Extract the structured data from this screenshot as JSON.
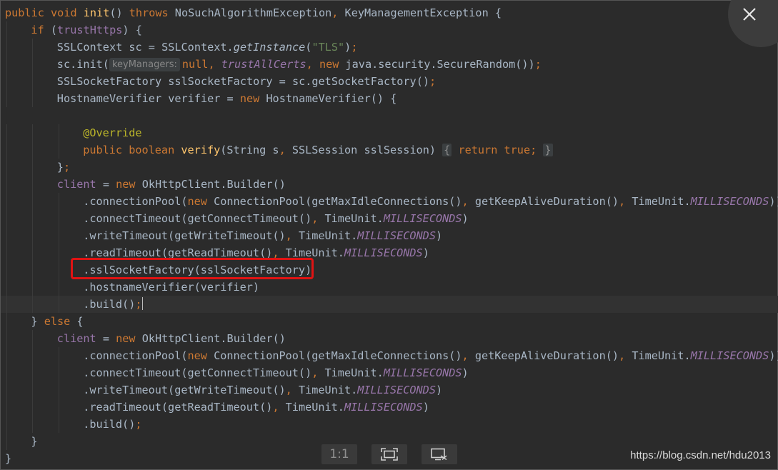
{
  "viewer": {
    "zoom_label": "1:1",
    "close_icon": "close-icon",
    "fit_icon": "fit-screen-icon",
    "crop_icon": "screenshot-crop-icon",
    "watermark": "https://blog.csdn.net/hdu2013"
  },
  "editor": {
    "highlight_color": "#e01313",
    "lines": [
      "public void init() throws NoSuchAlgorithmException, KeyManagementException {",
      "    if (trustHttps) {",
      "        SSLContext sc = SSLContext.getInstance(\"TLS\");",
      "        sc.init( keyManagers: null, trustAllCerts, new java.security.SecureRandom());",
      "        SSLSocketFactory sslSocketFactory = sc.getSocketFactory();",
      "        HostnameVerifier verifier = new HostnameVerifier() {",
      "",
      "            @Override",
      "            public boolean verify(String s, SSLSession sslSession) { return true; }",
      "        };",
      "        client = new OkHttpClient.Builder()",
      "            .connectionPool(new ConnectionPool(getMaxIdleConnections(), getKeepAliveDuration(), TimeUnit.MILLISECONDS))",
      "            .connectTimeout(getConnectTimeout(), TimeUnit.MILLISECONDS)",
      "            .writeTimeout(getWriteTimeout(), TimeUnit.MILLISECONDS)",
      "            .readTimeout(getReadTimeout(), TimeUnit.MILLISECONDS)",
      "            .sslSocketFactory(sslSocketFactory)",
      "            .hostnameVerifier(verifier)",
      "            .build();",
      "    } else {",
      "        client = new OkHttpClient.Builder()",
      "            .connectionPool(new ConnectionPool(getMaxIdleConnections(), getKeepAliveDuration(), TimeUnit.MILLISECONDS))",
      "            .connectTimeout(getConnectTimeout(), TimeUnit.MILLISECONDS)",
      "            .writeTimeout(getWriteTimeout(), TimeUnit.MILLISECONDS)",
      "            .readTimeout(getReadTimeout(), TimeUnit.MILLISECONDS)",
      "            .build();",
      "    }",
      "}"
    ]
  }
}
